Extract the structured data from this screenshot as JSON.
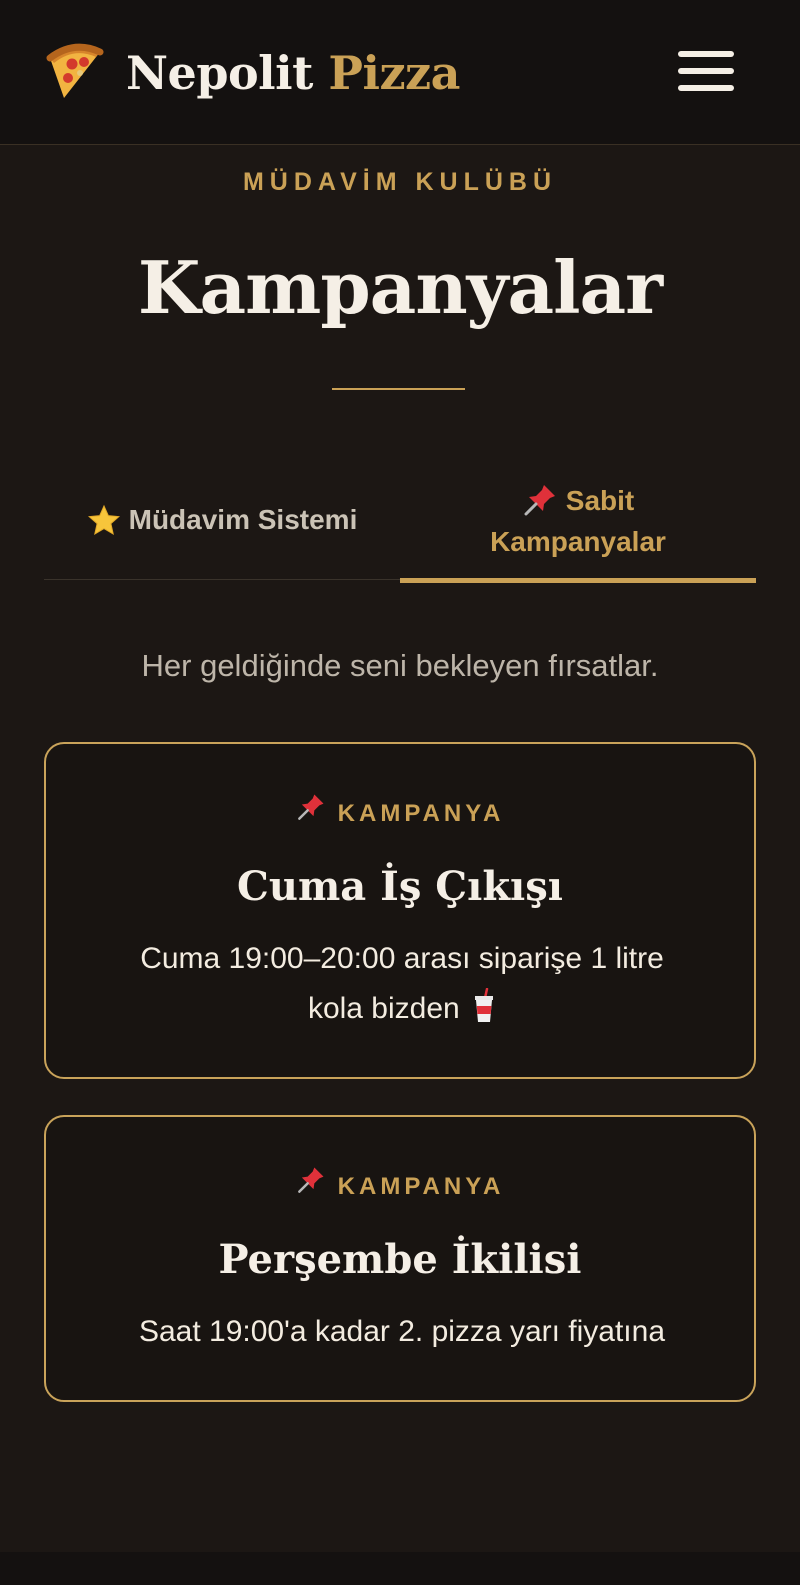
{
  "header": {
    "brand_part1": "Nepolit",
    "brand_part2": "Pizza",
    "logo_icon": "pizza-slice-icon",
    "menu_icon": "hamburger-menu-icon"
  },
  "hero": {
    "eyebrow": "MÜDAVİM KULÜBÜ",
    "title": "Kampanyalar"
  },
  "tabs": [
    {
      "icon": "star-icon",
      "label": "Müdavim Sistemi",
      "active": false
    },
    {
      "icon": "pushpin-icon",
      "label_line1": "Sabit",
      "label_line2": "Kampanyalar",
      "active": true
    }
  ],
  "intro": "Her geldiğinde seni bekleyen fırsatlar.",
  "campaigns": [
    {
      "label": "KAMPANYA",
      "title": "Cuma İş Çıkışı",
      "desc_line1": "Cuma 19:00–20:00 arası siparişe 1 litre",
      "desc_line2": "kola bizden",
      "desc_icon": "soda-cup-icon"
    },
    {
      "label": "KAMPANYA",
      "title": "Perşembe İkilisi",
      "desc_line1": "Saat 19:00'a kadar 2. pizza yarı fiyatına"
    }
  ],
  "colors": {
    "background": "#1c1714",
    "header": "#141110",
    "accent_gold": "#caa156",
    "text_light": "#f5efe6",
    "muted": "#bdb5a9"
  }
}
